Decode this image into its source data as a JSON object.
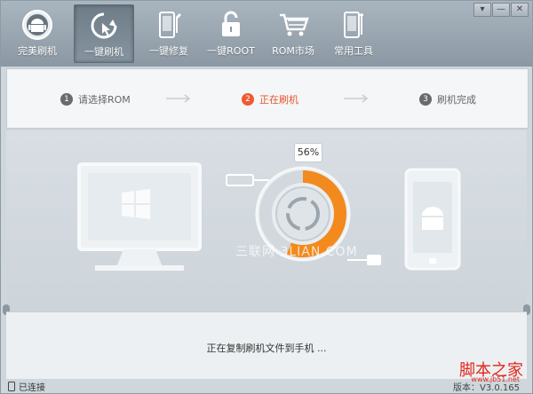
{
  "toolbar": {
    "items": [
      {
        "label": "完美刷机",
        "icon": "android-robot-icon"
      },
      {
        "label": "一键刷机",
        "icon": "refresh-hand-icon"
      },
      {
        "label": "一键修复",
        "icon": "phone-wrench-icon"
      },
      {
        "label": "一键ROOT",
        "icon": "unlock-icon"
      },
      {
        "label": "ROM市场",
        "icon": "cart-icon"
      },
      {
        "label": "常用工具",
        "icon": "phone-tools-icon"
      }
    ],
    "window_controls": [
      "▾",
      "—",
      "✕"
    ]
  },
  "steps": [
    {
      "num": "1",
      "label": "请选择ROM"
    },
    {
      "num": "2",
      "label": "正在刷机"
    },
    {
      "num": "3",
      "label": "刷机完成"
    }
  ],
  "progress": {
    "percent_label": "56%",
    "value": 0.56
  },
  "watermark": "三联网 3LIAN.COM",
  "status_message": "正在复制刷机文件到手机 ...",
  "statusbar": {
    "connection": "已连接",
    "version": "版本：V3.0.165"
  },
  "brand": {
    "name": "脚本之家",
    "url": "www.jb51.net"
  },
  "colors": {
    "accent": "#ef5a33",
    "progress": "#f28a1e",
    "toolbar": "#9aa6b0"
  }
}
